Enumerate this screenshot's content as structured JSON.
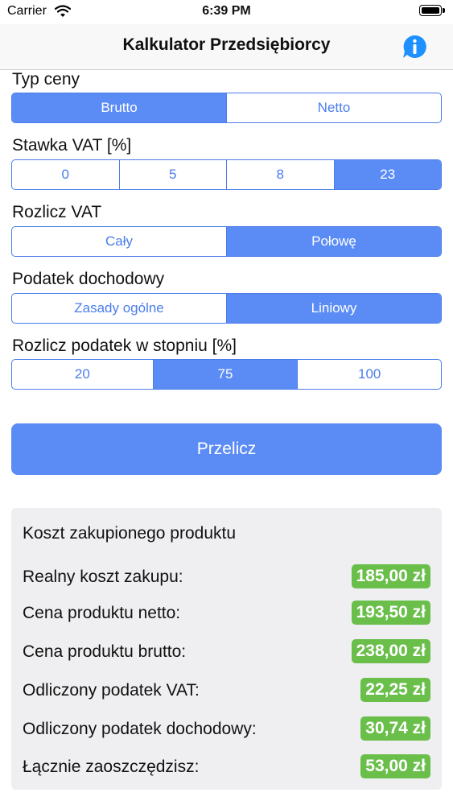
{
  "status": {
    "carrier": "Carrier",
    "time": "6:39 PM"
  },
  "nav": {
    "title": "Kalkulator Przedsiębiorcy"
  },
  "sections": [
    {
      "label": "Typ ceny",
      "options": [
        "Brutto",
        "Netto"
      ],
      "selected": 0
    },
    {
      "label": "Stawka VAT [%]",
      "options": [
        "0",
        "5",
        "8",
        "23"
      ],
      "selected": 3
    },
    {
      "label": "Rozlicz VAT",
      "options": [
        "Cały",
        "Połowę"
      ],
      "selected": 1
    },
    {
      "label": "Podatek dochodowy",
      "options": [
        "Zasady ogólne",
        "Liniowy"
      ],
      "selected": 1
    },
    {
      "label": "Rozlicz podatek w stopniu [%]",
      "options": [
        "20",
        "75",
        "100"
      ],
      "selected": 1
    }
  ],
  "action": {
    "label": "Przelicz"
  },
  "results": {
    "title": "Koszt zakupionego produktu",
    "rows": [
      {
        "label": "Realny koszt zakupu:",
        "value": "185,00 zł"
      },
      {
        "label": "Cena produktu netto:",
        "value": "193,50 zł"
      },
      {
        "label": "Cena produktu brutto:",
        "value": "238,00 zł"
      },
      {
        "label": "Odliczony podatek VAT:",
        "value": "22,25 zł"
      },
      {
        "label": "Odliczony podatek dochodowy:",
        "value": "30,74 zł"
      },
      {
        "label": "Łącznie zaoszczędzisz:",
        "value": "53,00 zł"
      }
    ]
  },
  "colors": {
    "accent": "#5b8cf5",
    "badge": "#6abf4b",
    "card": "#efeff1"
  }
}
